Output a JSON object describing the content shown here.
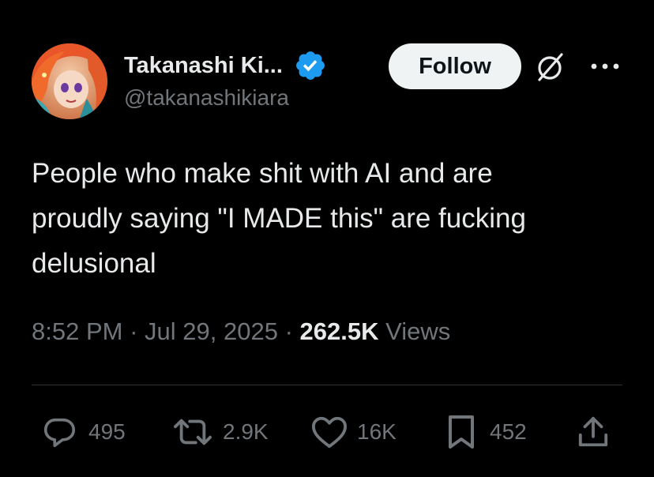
{
  "author": {
    "display_name": "Takanashi Ki...",
    "handle": "@takanashikiara",
    "verified": true,
    "accent_color": "#1d9bf0"
  },
  "header": {
    "follow_label": "Follow",
    "icons": [
      "grok-icon",
      "more-icon"
    ]
  },
  "tweet": {
    "lines": [
      "People who make shit with AI and are",
      "proudly saying \"I MADE this\" are fucking",
      "delusional"
    ]
  },
  "meta": {
    "time": "8:52 PM",
    "separator": "·",
    "date": "Jul 29, 2025",
    "views_count": "262.5K",
    "views_label": "Views"
  },
  "actions": {
    "reply": {
      "icon": "reply-icon",
      "count": "495"
    },
    "retweet": {
      "icon": "retweet-icon",
      "count": "2.9K"
    },
    "like": {
      "icon": "heart-icon",
      "count": "16K"
    },
    "bookmark": {
      "icon": "bookmark-icon",
      "count": "452"
    },
    "share": {
      "icon": "share-icon"
    }
  },
  "colors": {
    "background": "#000000",
    "text": "#e7e9ea",
    "muted": "#71767b",
    "divider": "#2f3336",
    "follow_button_bg": "#eff3f4"
  }
}
